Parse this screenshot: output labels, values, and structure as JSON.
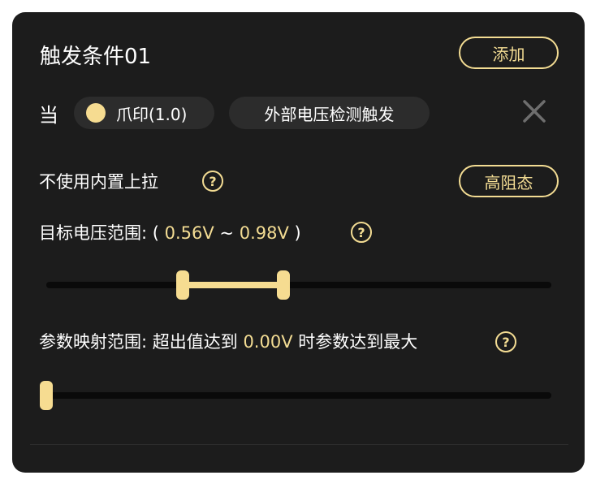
{
  "header": {
    "title": "触发条件01",
    "add_label": "添加"
  },
  "condition": {
    "when_label": "当",
    "device_chip": "爪印(1.0)",
    "trigger_chip": "外部电压检测触发",
    "device_dot_color": "#f6dc91"
  },
  "pullup": {
    "label": "不使用内置上拉",
    "mode_label": "高阻态"
  },
  "voltage_range": {
    "label_prefix": "目标电压范围: ( ",
    "low": "0.56V",
    "separator": " ~ ",
    "high": "0.98V",
    "label_suffix": " )",
    "low_fraction": 0.27,
    "high_fraction": 0.47
  },
  "mapping_range": {
    "label_prefix": "参数映射范围: 超出值达到 ",
    "value": "0.00V",
    "label_suffix": " 时参数达到最大",
    "value_fraction": 0.0
  },
  "help_symbol": "?",
  "colors": {
    "accent": "#f3dc93",
    "panel_bg": "#1c1c1c",
    "chip_bg": "#2c2c2c"
  }
}
